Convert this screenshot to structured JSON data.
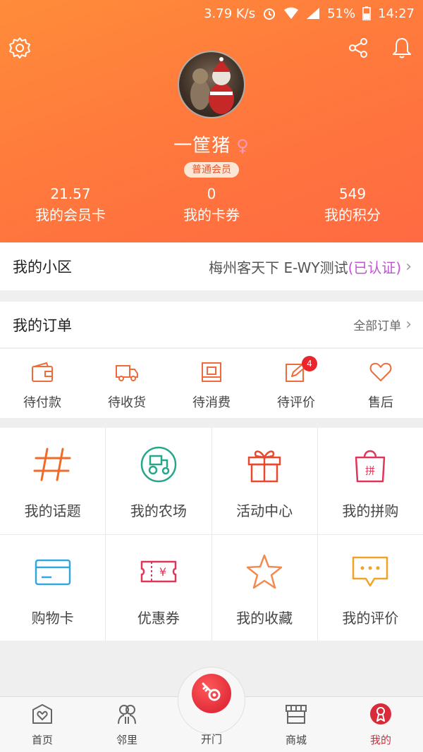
{
  "status_bar": {
    "speed": "3.79 K/s",
    "battery": "51%",
    "time": "14:27"
  },
  "profile": {
    "username": "一筐猪",
    "gender_symbol": "♀",
    "member_level": "普通会员"
  },
  "stats": [
    {
      "value": "21.57",
      "label": "我的会员卡"
    },
    {
      "value": "0",
      "label": "我的卡券"
    },
    {
      "value": "549",
      "label": "我的积分"
    }
  ],
  "community": {
    "title": "我的小区",
    "name": "梅州客天下 E-WY测试",
    "status": "(已认证)"
  },
  "orders": {
    "title": "我的订单",
    "all_label": "全部订单",
    "items": [
      {
        "label": "待付款",
        "icon": "wallet-icon"
      },
      {
        "label": "待收货",
        "icon": "truck-icon"
      },
      {
        "label": "待消费",
        "icon": "ticket-box-icon"
      },
      {
        "label": "待评价",
        "icon": "edit-icon",
        "badge": "4"
      },
      {
        "label": "售后",
        "icon": "heart-icon"
      }
    ]
  },
  "services": [
    {
      "label": "我的话题",
      "icon": "hashtag-icon",
      "color": "#f06a2a"
    },
    {
      "label": "我的农场",
      "icon": "tractor-icon",
      "color": "#26a68a"
    },
    {
      "label": "活动中心",
      "icon": "gift-icon",
      "color": "#e8492f"
    },
    {
      "label": "我的拼购",
      "icon": "shopping-bag-icon",
      "color": "#e0365a"
    },
    {
      "label": "购物卡",
      "icon": "card-icon",
      "color": "#33a7dc"
    },
    {
      "label": "优惠券",
      "icon": "coupon-icon",
      "color": "#e0365a"
    },
    {
      "label": "我的收藏",
      "icon": "star-icon",
      "color": "#f28a52"
    },
    {
      "label": "我的评价",
      "icon": "comment-icon",
      "color": "#f0a327"
    }
  ],
  "bottom_nav": {
    "home": "首页",
    "neighbors": "邻里",
    "open_door": "开门",
    "mall": "商城",
    "mine": "我的"
  },
  "colors": {
    "accent": "#ff7a3c",
    "active": "#d92b3a",
    "verified": "#c352d6"
  }
}
